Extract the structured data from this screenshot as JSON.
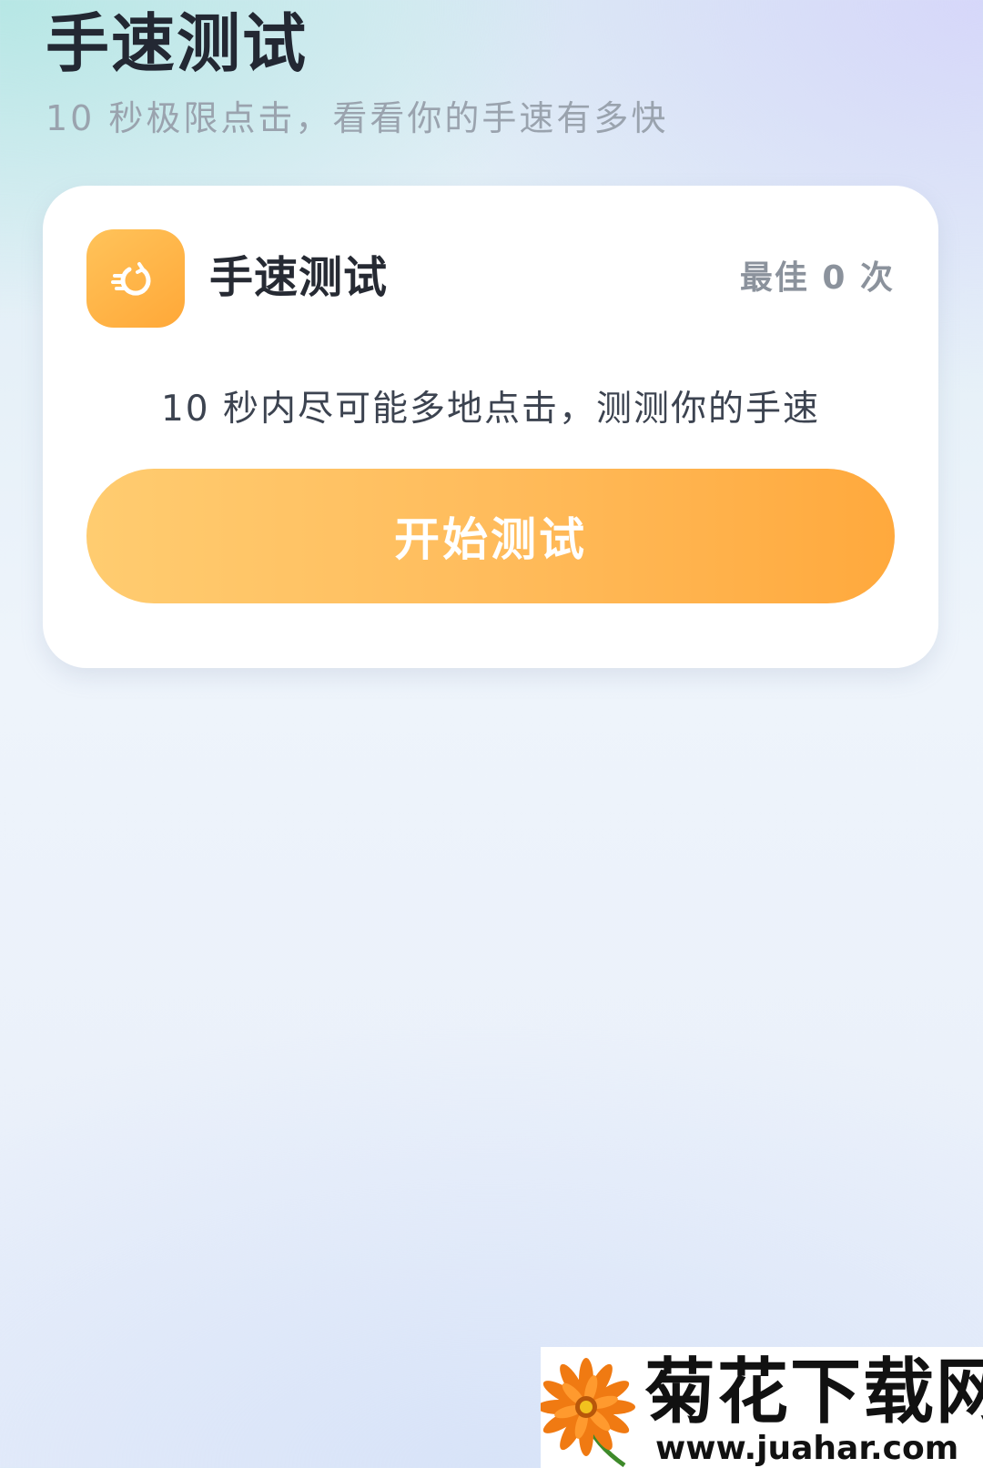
{
  "header": {
    "title": "手速测试",
    "subtitle": "10 秒极限点击，看看你的手速有多快"
  },
  "card": {
    "icon": "speed-tap-icon",
    "title": "手速测试",
    "best_score": "最佳 0 次",
    "description": "10 秒内尽可能多地点击，测测你的手速",
    "start_label": "开始测试"
  },
  "watermark": {
    "logo": "chrysanthemum-flower-logo",
    "title": "菊花下载网",
    "url": "www.juahar.com"
  },
  "colors": {
    "accent_start": "#ffcc70",
    "accent_end": "#ffa93d",
    "title_text": "#232833",
    "muted_text": "#9aa3ae",
    "card_bg": "#ffffff"
  }
}
